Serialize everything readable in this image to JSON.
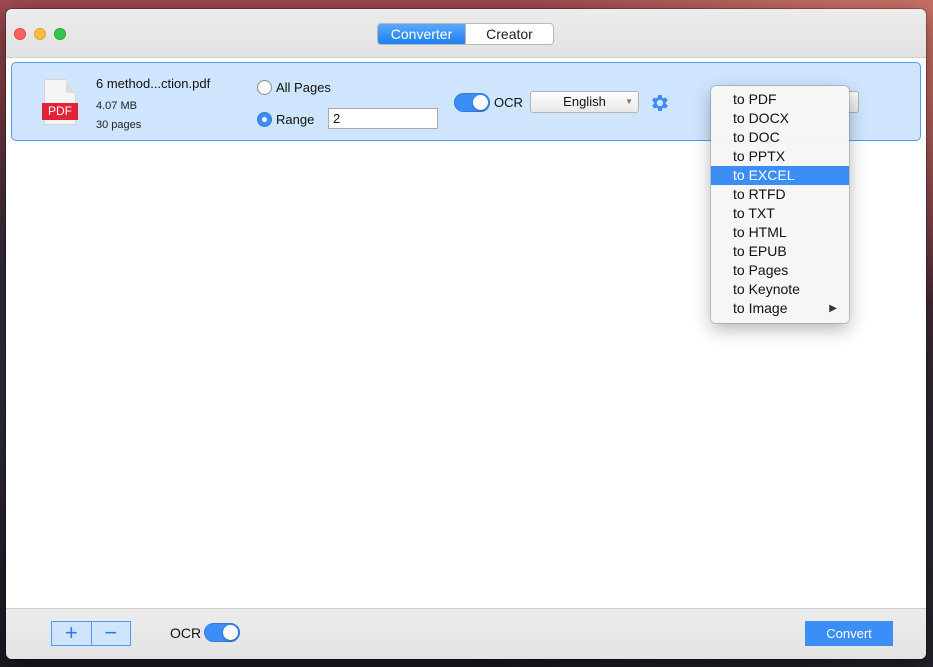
{
  "window": {
    "tabs": [
      {
        "label": "Converter",
        "active": true
      },
      {
        "label": "Creator",
        "active": false
      }
    ]
  },
  "file": {
    "name": "6 method...ction.pdf",
    "size": "4.07 MB",
    "pages": "30 pages",
    "icon_badge": "PDF"
  },
  "page_options": {
    "all_pages_label": "All Pages",
    "range_label": "Range",
    "range_value": "2",
    "selected": "Range"
  },
  "ocr": {
    "label": "OCR",
    "enabled": true,
    "language": "English"
  },
  "format_menu": {
    "items": [
      "to PDF",
      "to DOCX",
      "to DOC",
      "to PPTX",
      "to EXCEL",
      "to RTFD",
      "to TXT",
      "to HTML",
      "to EPUB",
      "to Pages",
      "to Keynote",
      "to Image"
    ],
    "selected": "to EXCEL"
  },
  "bottom": {
    "add_label": "+",
    "remove_label": "−",
    "ocr_label": "OCR",
    "ocr_enabled": true,
    "convert_label": "Convert"
  },
  "colors": {
    "accent": "#3b8ef5",
    "row_highlight": "#cfe5fe",
    "pdf_badge": "#e1233a"
  }
}
